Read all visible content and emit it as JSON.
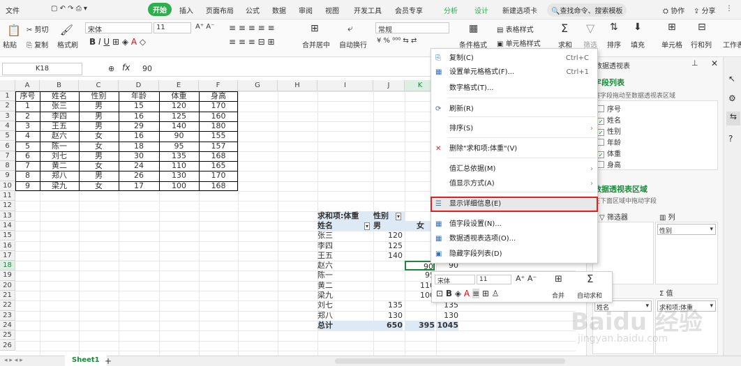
{
  "menubar": {
    "file": "文件",
    "tabs": [
      "开始",
      "插入",
      "页面布局",
      "公式",
      "数据",
      "审阅",
      "视图",
      "开发工具",
      "会员专享",
      "分析",
      "设计",
      "新建选项卡"
    ],
    "search": "查找命令、搜索模板",
    "collab": "协作",
    "share": "分享"
  },
  "ribbon": {
    "cut": "剪切",
    "paste": "粘贴",
    "copy": "复制",
    "format_painter": "格式刷",
    "font": "宋体",
    "size": "11",
    "number_format": "常规",
    "merge": "合并居中",
    "wrap": "自动换行",
    "cond_format": "条件格式",
    "table_style": "表格样式",
    "cell_style": "单元格样式",
    "sum": "求和",
    "filter": "筛选",
    "sort": "排序",
    "fill": "填充",
    "cells": "单元格",
    "rowcol": "行和列",
    "sheet": "工作表"
  },
  "formula_bar": {
    "cell_ref": "K18",
    "fx": "fx",
    "value": "90"
  },
  "columns": [
    "A",
    "B",
    "C",
    "D",
    "E",
    "F",
    "G",
    "H",
    "I",
    "J",
    "K"
  ],
  "rows": [
    "1",
    "2",
    "3",
    "4",
    "5",
    "6",
    "7",
    "8",
    "9",
    "10",
    "11",
    "12",
    "13",
    "14",
    "15",
    "16",
    "17",
    "18",
    "19",
    "20",
    "21",
    "22",
    "23",
    "24",
    "25",
    "26"
  ],
  "table": {
    "headers": [
      "序号",
      "姓名",
      "性别",
      "年龄",
      "体重",
      "身高"
    ],
    "rows": [
      [
        "1",
        "张三",
        "男",
        "15",
        "120",
        "170"
      ],
      [
        "2",
        "李四",
        "男",
        "16",
        "125",
        "160"
      ],
      [
        "3",
        "王五",
        "男",
        "29",
        "140",
        "180"
      ],
      [
        "4",
        "赵六",
        "女",
        "16",
        "90",
        "155"
      ],
      [
        "5",
        "陈一",
        "女",
        "18",
        "95",
        "157"
      ],
      [
        "6",
        "刘七",
        "男",
        "30",
        "135",
        "168"
      ],
      [
        "7",
        "黄二",
        "女",
        "24",
        "110",
        "165"
      ],
      [
        "8",
        "郑八",
        "男",
        "26",
        "130",
        "170"
      ],
      [
        "9",
        "梁九",
        "女",
        "17",
        "100",
        "168"
      ]
    ]
  },
  "pivot": {
    "title": "求和项:体重",
    "col_field": "性别",
    "row_field": "姓名",
    "col_male": "男",
    "col_female": "女",
    "rows": [
      [
        "张三",
        "120",
        "",
        ""
      ],
      [
        "李四",
        "125",
        "",
        ""
      ],
      [
        "王五",
        "140",
        "",
        ""
      ],
      [
        "赵六",
        "",
        "90",
        "90"
      ],
      [
        "陈一",
        "",
        "95",
        ""
      ],
      [
        "黄二",
        "",
        "110",
        ""
      ],
      [
        "梁九",
        "",
        "100",
        ""
      ],
      [
        "刘七",
        "135",
        "",
        "135"
      ],
      [
        "郑八",
        "130",
        "",
        "130"
      ]
    ],
    "total_label": "总计",
    "total_male": "650",
    "total_female": "395",
    "total_all": "1045"
  },
  "context_menu": {
    "items": [
      {
        "label": "复制(C)",
        "shortcut": "Ctrl+C"
      },
      {
        "label": "设置单元格格式(F)...",
        "shortcut": "Ctrl+1"
      },
      {
        "label": "数字格式(T)..."
      },
      {
        "label": "刷新(R)"
      },
      {
        "label": "排序(S)"
      },
      {
        "label": "删除\"求和项:体重\"(V)"
      },
      {
        "label": "值汇总依据(M)"
      },
      {
        "label": "值显示方式(A)"
      },
      {
        "label": "显示详细信息(E)"
      },
      {
        "label": "值字段设置(N)..."
      },
      {
        "label": "数据透视表选项(O)..."
      },
      {
        "label": "隐藏字段列表(D)"
      }
    ]
  },
  "mini_toolbar": {
    "font": "宋体",
    "size": "11",
    "merge": "合并",
    "autosum": "自动求和"
  },
  "pivot_panel": {
    "header": "数据透视表",
    "field_list": "字段列表",
    "drag_hint": "将字段拖动至数据透视表区域",
    "fields": [
      {
        "name": "序号",
        "checked": false
      },
      {
        "name": "姓名",
        "checked": true
      },
      {
        "name": "性别",
        "checked": true
      },
      {
        "name": "年龄",
        "checked": false
      },
      {
        "name": "体重",
        "checked": true
      },
      {
        "name": "身高",
        "checked": false
      }
    ],
    "area_title": "数据透视表区域",
    "area_hint": "在下面区域中拖动字段",
    "filter": "筛选器",
    "col": "列",
    "col_value": "性别",
    "row_value": "姓名",
    "val": "值",
    "val_value": "求和项:体重"
  },
  "sheet_tab": "Sheet1",
  "watermark": "Baidu 经验",
  "watermark_url": "jingyan.baidu.com"
}
